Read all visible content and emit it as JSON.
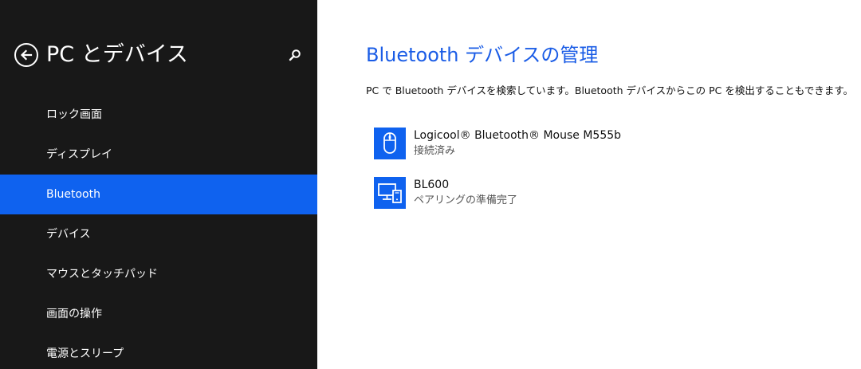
{
  "sidebar": {
    "title": "PC とデバイス",
    "back_icon": "back-arrow-icon",
    "search_icon": "search-icon",
    "items": [
      {
        "label": "ロック画面",
        "active": false
      },
      {
        "label": "ディスプレイ",
        "active": false
      },
      {
        "label": "Bluetooth",
        "active": true
      },
      {
        "label": "デバイス",
        "active": false
      },
      {
        "label": "マウスとタッチパッド",
        "active": false
      },
      {
        "label": "画面の操作",
        "active": false
      },
      {
        "label": "電源とスリープ",
        "active": false
      }
    ]
  },
  "main": {
    "title": "Bluetooth デバイスの管理",
    "description": "PC で Bluetooth デバイスを検索しています。Bluetooth デバイスからこの PC を検出することもできます。",
    "devices": [
      {
        "name": "Logicool® Bluetooth® Mouse M555b",
        "status": "接続済み",
        "icon": "mouse-icon"
      },
      {
        "name": "BL600",
        "status": "ペアリングの準備完了",
        "icon": "devices-icon"
      }
    ]
  },
  "colors": {
    "sidebar_bg": "#181818",
    "accent": "#0f62ef",
    "title_blue": "#1a5ce6"
  }
}
